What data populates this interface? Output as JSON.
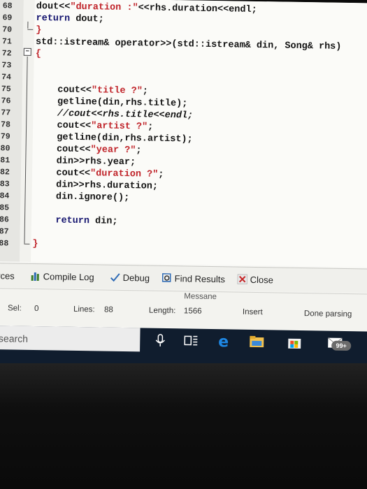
{
  "editor": {
    "lines": [
      {
        "n": "68",
        "tokens": [
          {
            "t": "dout<<",
            "c": "plain"
          },
          {
            "t": "\"duration :\"",
            "c": "str"
          },
          {
            "t": "<<rhs.duration<<endl;",
            "c": "plain"
          }
        ]
      },
      {
        "n": "69",
        "tokens": [
          {
            "t": "return",
            "c": "kw"
          },
          {
            "t": " dout;",
            "c": "plain"
          }
        ]
      },
      {
        "n": "70",
        "tokens": [
          {
            "t": "}",
            "c": "str"
          }
        ]
      },
      {
        "n": "71",
        "tokens": [
          {
            "t": "std::istream& operator>>(std::istream& din, Song& rhs)",
            "c": "plain"
          }
        ]
      },
      {
        "n": "72",
        "tokens": [
          {
            "t": "{",
            "c": "str"
          }
        ]
      },
      {
        "n": "73",
        "tokens": []
      },
      {
        "n": "74",
        "tokens": []
      },
      {
        "n": "75",
        "tokens": [
          {
            "t": "    cout<<",
            "c": "plain"
          },
          {
            "t": "\"title ?\"",
            "c": "str"
          },
          {
            "t": ";",
            "c": "plain"
          }
        ]
      },
      {
        "n": "76",
        "tokens": [
          {
            "t": "    getline(din,rhs.title);",
            "c": "plain"
          }
        ]
      },
      {
        "n": "77",
        "tokens": [
          {
            "t": "    //cout<<rhs.title<<endl;",
            "c": "cmt"
          }
        ]
      },
      {
        "n": "78",
        "tokens": [
          {
            "t": "    cout<<",
            "c": "plain"
          },
          {
            "t": "\"artist ?\"",
            "c": "str"
          },
          {
            "t": ";",
            "c": "plain"
          }
        ]
      },
      {
        "n": "79",
        "tokens": [
          {
            "t": "    getline(din,rhs.artist);",
            "c": "plain"
          }
        ]
      },
      {
        "n": "80",
        "tokens": [
          {
            "t": "    cout<<",
            "c": "plain"
          },
          {
            "t": "\"year ?\"",
            "c": "str"
          },
          {
            "t": ";",
            "c": "plain"
          }
        ]
      },
      {
        "n": "81",
        "tokens": [
          {
            "t": "    din>>rhs.year;",
            "c": "plain"
          }
        ]
      },
      {
        "n": "82",
        "tokens": [
          {
            "t": "    cout<<",
            "c": "plain"
          },
          {
            "t": "\"duration ?\"",
            "c": "str"
          },
          {
            "t": ";",
            "c": "plain"
          }
        ]
      },
      {
        "n": "83",
        "tokens": [
          {
            "t": "    din>>rhs.duration;",
            "c": "plain"
          }
        ]
      },
      {
        "n": "84",
        "tokens": [
          {
            "t": "    din.ignore();",
            "c": "plain"
          }
        ]
      },
      {
        "n": "85",
        "tokens": []
      },
      {
        "n": "86",
        "tokens": [
          {
            "t": "    return",
            "c": "kw"
          },
          {
            "t": " din;",
            "c": "plain"
          }
        ]
      },
      {
        "n": "87",
        "tokens": []
      },
      {
        "n": "88",
        "tokens": [
          {
            "t": "}",
            "c": "str"
          }
        ]
      }
    ]
  },
  "tabs": {
    "resources": "ources",
    "compile_log": "Compile Log",
    "debug": "Debug",
    "find_results": "Find Results",
    "close": "Close"
  },
  "status": {
    "message_header": "Messane",
    "sel_label": "Sel:",
    "sel_value": "0",
    "lines_label": "Lines:",
    "lines_value": "88",
    "length_label": "Length:",
    "length_value": "1566",
    "insert": "Insert",
    "done": "Done parsing"
  },
  "taskbar": {
    "search_placeholder": "o search",
    "notification_badge": "99+",
    "icons": [
      "microphone-icon",
      "task-view-icon",
      "edge-icon",
      "file-explorer-icon",
      "store-icon",
      "mail-icon"
    ]
  },
  "colors": {
    "keyword": "#161670",
    "string": "#c0242a",
    "taskbar": "#101d2e",
    "edge_blue": "#1e88e5"
  }
}
